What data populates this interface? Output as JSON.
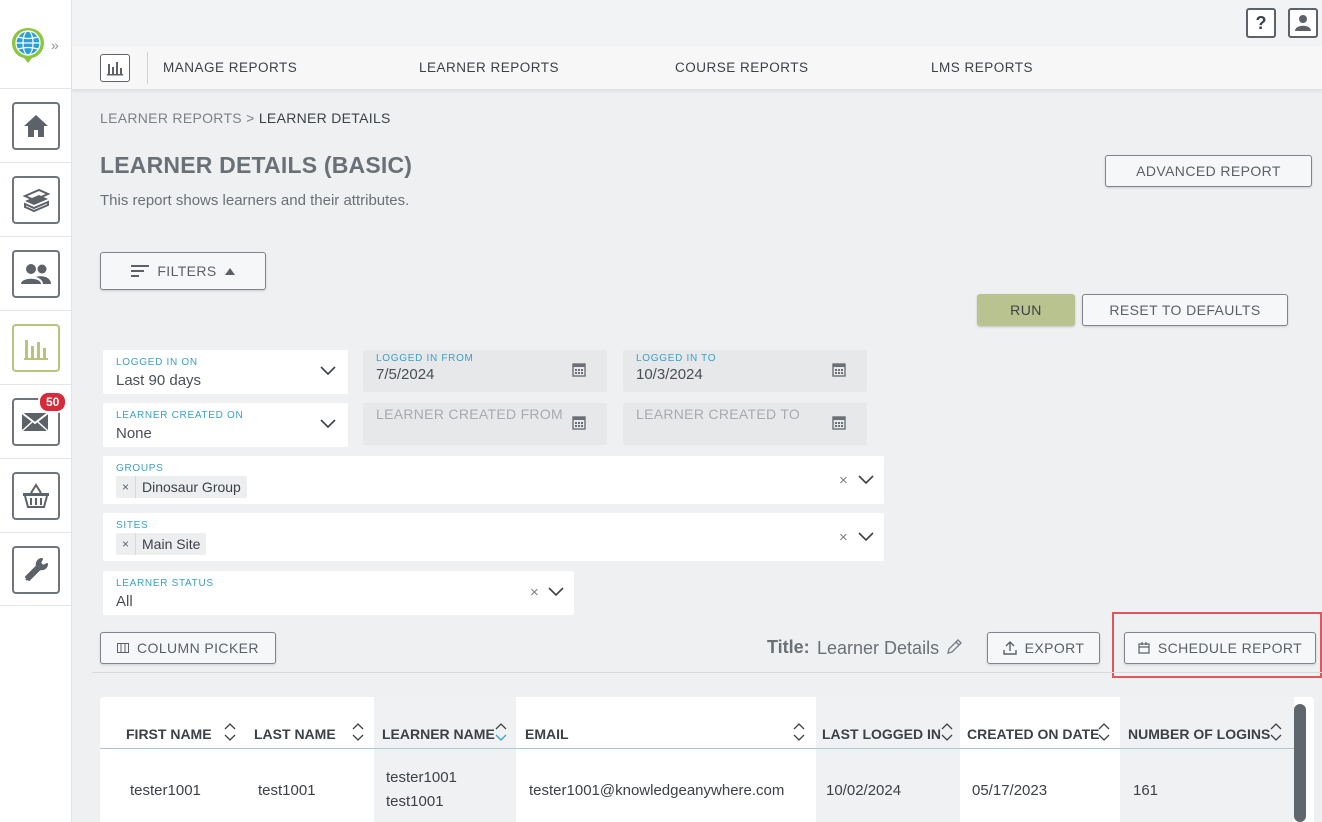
{
  "nav": {
    "tabs": [
      "MANAGE REPORTS",
      "LEARNER REPORTS",
      "COURSE REPORTS",
      "LMS REPORTS"
    ],
    "help_label": "?",
    "mail_badge": "50",
    "expand_glyph": "»"
  },
  "sidebar_icons": [
    "home-icon",
    "courses-icon",
    "users-icon",
    "reports-icon",
    "mail-icon",
    "cart-icon",
    "wrench-icon"
  ],
  "breadcrumb": {
    "parent": "LEARNER REPORTS",
    "separator": ">",
    "current": "LEARNER DETAILS"
  },
  "page": {
    "title": "LEARNER DETAILS (BASIC)",
    "subtitle": "This report shows learners and their attributes.",
    "advanced_button": "ADVANCED REPORT",
    "filters_button": "FILTERS",
    "run_button": "RUN",
    "reset_button": "RESET TO DEFAULTS"
  },
  "filters": {
    "logged_in_on": {
      "label": "LOGGED IN ON",
      "value": "Last 90 days"
    },
    "logged_in_from": {
      "label": "LOGGED IN FROM",
      "value": "7/5/2024"
    },
    "logged_in_to": {
      "label": "LOGGED IN TO",
      "value": "10/3/2024"
    },
    "learner_created_on": {
      "label": "LEARNER CREATED ON",
      "value": "None"
    },
    "learner_created_from": {
      "placeholder": "LEARNER CREATED FROM"
    },
    "learner_created_to": {
      "placeholder": "LEARNER CREATED TO"
    },
    "groups": {
      "label": "GROUPS",
      "chip": "Dinosaur Group"
    },
    "sites": {
      "label": "SITES",
      "chip": "Main Site"
    },
    "learner_status": {
      "label": "LEARNER STATUS",
      "value": "All"
    }
  },
  "toolbar": {
    "column_picker": "COLUMN PICKER",
    "title_label": "Title:",
    "title_value": "Learner Details",
    "export": "EXPORT",
    "schedule": "SCHEDULE REPORT"
  },
  "table": {
    "columns": [
      "FIRST NAME",
      "LAST NAME",
      "LEARNER NAME",
      "EMAIL",
      "LAST LOGGED IN",
      "CREATED ON DATE",
      "NUMBER OF LOGINS"
    ],
    "rows": [
      [
        "tester1001",
        "test1001",
        "tester1001 test1001",
        "tester1001@knowledgeanywhere.com",
        "10/02/2024",
        "05/17/2023",
        "161"
      ]
    ],
    "learner_name_line1": "tester1001",
    "learner_name_line2": "test1001"
  },
  "colors": {
    "accent": "#3aa0c8",
    "run": "#b9c38f",
    "badge": "#d62b3a",
    "highlight": "#e0565a"
  }
}
